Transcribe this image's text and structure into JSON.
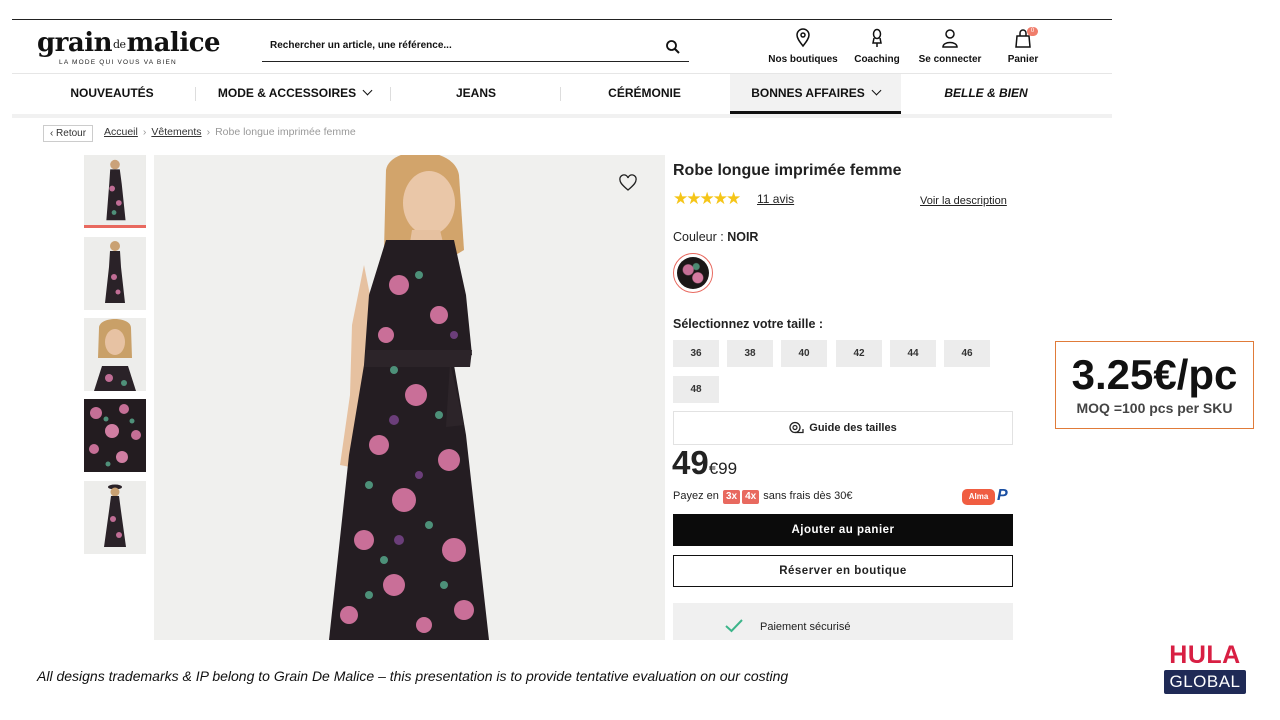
{
  "header": {
    "logo_main": "grain",
    "logo_small": "de",
    "logo_end": "malice",
    "logo_tagline": "LA MODE QUI VOUS VA BIEN",
    "search_placeholder": "Rechercher un article, une référence...",
    "items": [
      {
        "label": "Nos boutiques",
        "icon": "location-pin-icon"
      },
      {
        "label": "Coaching",
        "icon": "coaching-icon"
      },
      {
        "label": "Se connecter",
        "icon": "user-icon"
      },
      {
        "label": "Panier",
        "icon": "bag-icon",
        "badge": "0"
      }
    ]
  },
  "nav": {
    "items": [
      {
        "label": "NOUVEAUTÉS"
      },
      {
        "label": "MODE & ACCESSOIRES"
      },
      {
        "label": "JEANS"
      },
      {
        "label": "CÉRÉMONIE"
      },
      {
        "label": "BONNES AFFAIRES"
      },
      {
        "label": "BELLE & BIEN"
      }
    ]
  },
  "breadcrumb": {
    "back": "‹ Retour",
    "items": [
      "Accueil",
      "Vêtements",
      "Robe longue imprimée femme"
    ],
    "separator": "›"
  },
  "product": {
    "title": "Robe longue imprimée femme",
    "stars": "★★★★★",
    "reviews": "11 avis",
    "voir_description": "Voir la description",
    "couleur_label": "Couleur : ",
    "couleur_value": "NOIR",
    "size_title": "Sélectionnez votre taille :",
    "sizes": [
      "36",
      "38",
      "40",
      "42",
      "44",
      "46",
      "48"
    ],
    "guide": "Guide des tailles",
    "price_main": "49",
    "price_cents": "€99",
    "payez_prefix": "Payez en",
    "payez_3x": "3x",
    "payez_4x": "4x",
    "payez_suffix": "sans frais dès 30€",
    "alma": "Alma",
    "paypal": "P",
    "add_to_cart": "Ajouter au panier",
    "reserve": "Réserver en boutique",
    "secure": "Paiement sécurisé"
  },
  "overlay": {
    "price_per_pc": "3.25€/pc",
    "moq": "MOQ =100 pcs per SKU",
    "disclaimer": "All designs trademarks & IP belong to Grain De Malice – this presentation is to provide tentative evaluation on our costing",
    "brand_top": "HULA",
    "brand_bottom": "GLOBAL"
  },
  "colors": {
    "accent_coral": "#e8695f",
    "price_box_border": "#e07b39",
    "hula_red": "#d81f43",
    "hula_navy": "#1f2a56",
    "star_yellow": "#f5c518"
  }
}
